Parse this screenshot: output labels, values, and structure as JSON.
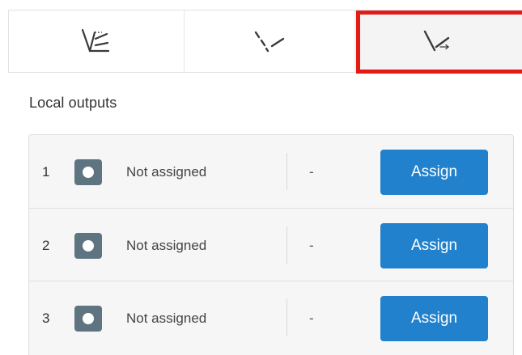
{
  "tabs": [
    {
      "icon": "axis-line-icon"
    },
    {
      "icon": "dashed-line-icon"
    },
    {
      "icon": "line-output-arrow-icon",
      "highlighted": true
    }
  ],
  "section": {
    "title": "Local outputs"
  },
  "outputs": [
    {
      "number": "1",
      "status": "Not assigned",
      "value": "-",
      "button_label": "Assign"
    },
    {
      "number": "2",
      "status": "Not assigned",
      "value": "-",
      "button_label": "Assign"
    },
    {
      "number": "3",
      "status": "Not assigned",
      "value": "-",
      "button_label": "Assign"
    }
  ],
  "colors": {
    "accent": "#2181cc",
    "highlight": "#e11b16",
    "status_icon": "#5e7480"
  }
}
